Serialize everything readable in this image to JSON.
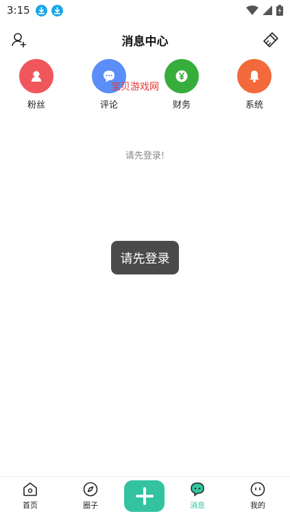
{
  "status_bar": {
    "time": "3:15",
    "icons": [
      "download-icon",
      "download-icon",
      "wifi-icon",
      "signal-icon",
      "battery-icon"
    ]
  },
  "header": {
    "title": "消息中心",
    "left_icon": "add-user-icon",
    "right_icon": "clear-icon"
  },
  "categories": [
    {
      "label": "粉丝",
      "color": "#f0575c",
      "icon": "person-icon"
    },
    {
      "label": "评论",
      "color": "#5b8ef8",
      "icon": "comment-icon"
    },
    {
      "label": "财务",
      "color": "#37ad3c",
      "icon": "yen-icon"
    },
    {
      "label": "系统",
      "color": "#f26a3b",
      "icon": "bell-icon"
    }
  ],
  "watermark": "宝贝游戏网",
  "login_hint": "请先登录!",
  "toast": "请先登录",
  "bottom_nav": {
    "items": [
      {
        "label": "首页",
        "icon": "home-icon"
      },
      {
        "label": "圈子",
        "icon": "compass-icon"
      },
      {
        "label": "消息",
        "icon": "message-icon",
        "active": true
      },
      {
        "label": "我的",
        "icon": "profile-icon"
      }
    ],
    "fab_icon": "plus-icon",
    "accent": "#33c3a0"
  }
}
